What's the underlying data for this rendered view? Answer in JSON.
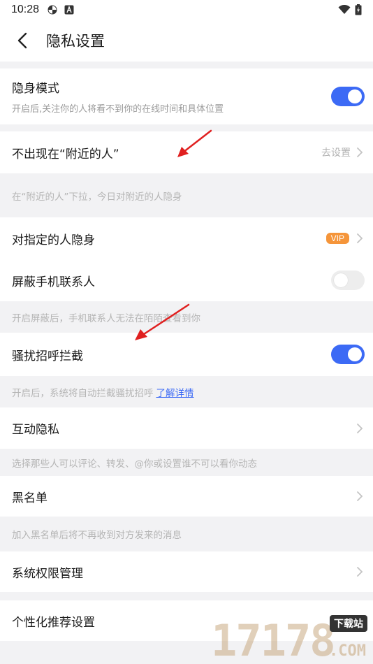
{
  "status_bar": {
    "time": "10:28"
  },
  "header": {
    "title": "隐私设置"
  },
  "settings": {
    "stealth": {
      "label": "隐身模式",
      "desc": "开启后,关注你的人将看不到你的在线时间和具体位置",
      "enabled": true
    },
    "nearby": {
      "label": "不出现在“附近的人”",
      "hint": "去设置",
      "note": "在“附近的人”下拉，今日对附近的人隐身"
    },
    "specified": {
      "label": "对指定的人隐身",
      "badge": "VIP"
    },
    "contacts": {
      "label": "屏蔽手机联系人",
      "enabled": false,
      "note": "开启屏蔽后，手机联系人无法在陌陌查看到你"
    },
    "harass": {
      "label": "骚扰招呼拦截",
      "enabled": true,
      "note": "开启后，系统将自动拦截骚扰招呼",
      "link": "了解详情"
    },
    "interaction": {
      "label": "互动隐私",
      "note": "选择那些人可以评论、转发、@你或设置谁不可以看你动态"
    },
    "blacklist": {
      "label": "黑名单",
      "note": "加入黑名单后将不再收到对方发来的消息"
    },
    "permissions": {
      "label": "系统权限管理"
    },
    "personalized": {
      "label": "个性化推荐设置"
    }
  },
  "watermark": {
    "digits": "17178",
    "badge": "下载站",
    "suffix": ".COM"
  },
  "colors": {
    "accent": "#3c6af5",
    "vip": "#f5953a",
    "annotation_arrow": "#e02020"
  }
}
